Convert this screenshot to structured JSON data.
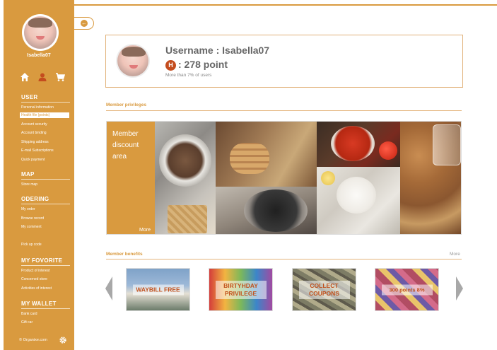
{
  "sidebar": {
    "username": "Isabella07",
    "sections": [
      {
        "title": "USER",
        "items": [
          "Personal information",
          "Health file (points)",
          "Account security",
          "Account binding",
          "Shipping address",
          "E-mail Subscriptions",
          "Quick payment"
        ]
      },
      {
        "title": "MAP",
        "items": [
          "Store map"
        ]
      },
      {
        "title": "ODERING",
        "items": [
          "My order",
          "Browse record",
          "My comment"
        ]
      },
      {
        "title": "",
        "items": [
          "Pick up  code"
        ]
      },
      {
        "title": "MY FOVORITE",
        "items": [
          "Product of interest",
          "Concerned store",
          "Activities of interest"
        ]
      },
      {
        "title": "MY WALLET",
        "items": [
          "Bank card",
          "Gift car"
        ]
      }
    ],
    "footer": "© Organixe.com",
    "icons": [
      "home-icon",
      "user-icon",
      "cart-icon",
      "gear-icon"
    ]
  },
  "profile": {
    "username_line": "Username :  Isabella07",
    "badge": "H",
    "points_line": ": 278 point",
    "rank_note": "More than 7% of users"
  },
  "privileges": {
    "label": "Member privileges",
    "panel_title": "Member discount area",
    "more": "More"
  },
  "benefits": {
    "label": "Member benefits",
    "more": "More",
    "cards": [
      "WAYBILL FREE",
      "BIRTYHDAY PRIVILEGE",
      "COLLECT COUPONS",
      "300 points 8%"
    ]
  },
  "colors": {
    "accent": "#d99a3f",
    "badge": "#c44c1e",
    "benefit_text": "#c1511c"
  }
}
